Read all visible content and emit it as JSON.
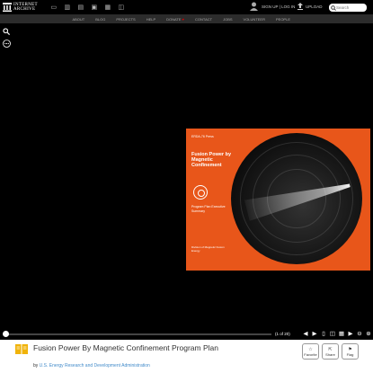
{
  "header": {
    "logo_line1": "INTERNET",
    "logo_line2": "ARCHIVE",
    "user_label": "SIGN UP | LOG IN",
    "upload_label": "UPLOAD",
    "search_placeholder": "Search"
  },
  "nav": {
    "items": [
      "ABOUT",
      "BLOG",
      "PROJECTS",
      "HELP",
      "DONATE",
      "CONTACT",
      "JOBS",
      "VOLUNTEER",
      "PEOPLE"
    ]
  },
  "book": {
    "series": "ERDA-76 Press",
    "title": "Fusion Power by Magnetic Confinement",
    "subtitle": "Program Plan Executive Summary",
    "footer": "Division of Magnetic Fusion Energy"
  },
  "controls": {
    "page_indicator": "(1 of 20)",
    "progress": 0.0
  },
  "item": {
    "title": "Fusion Power By Magnetic Confinement Program Plan",
    "by_prefix": "by",
    "author": "U.S. Energy Research and Development Administration"
  },
  "actions": {
    "favorite": "Favorite",
    "share": "Share",
    "flag": "Flag"
  },
  "colors": {
    "cover": "#e8561a",
    "link": "#428bca",
    "donate_heart": "#dd0000"
  }
}
